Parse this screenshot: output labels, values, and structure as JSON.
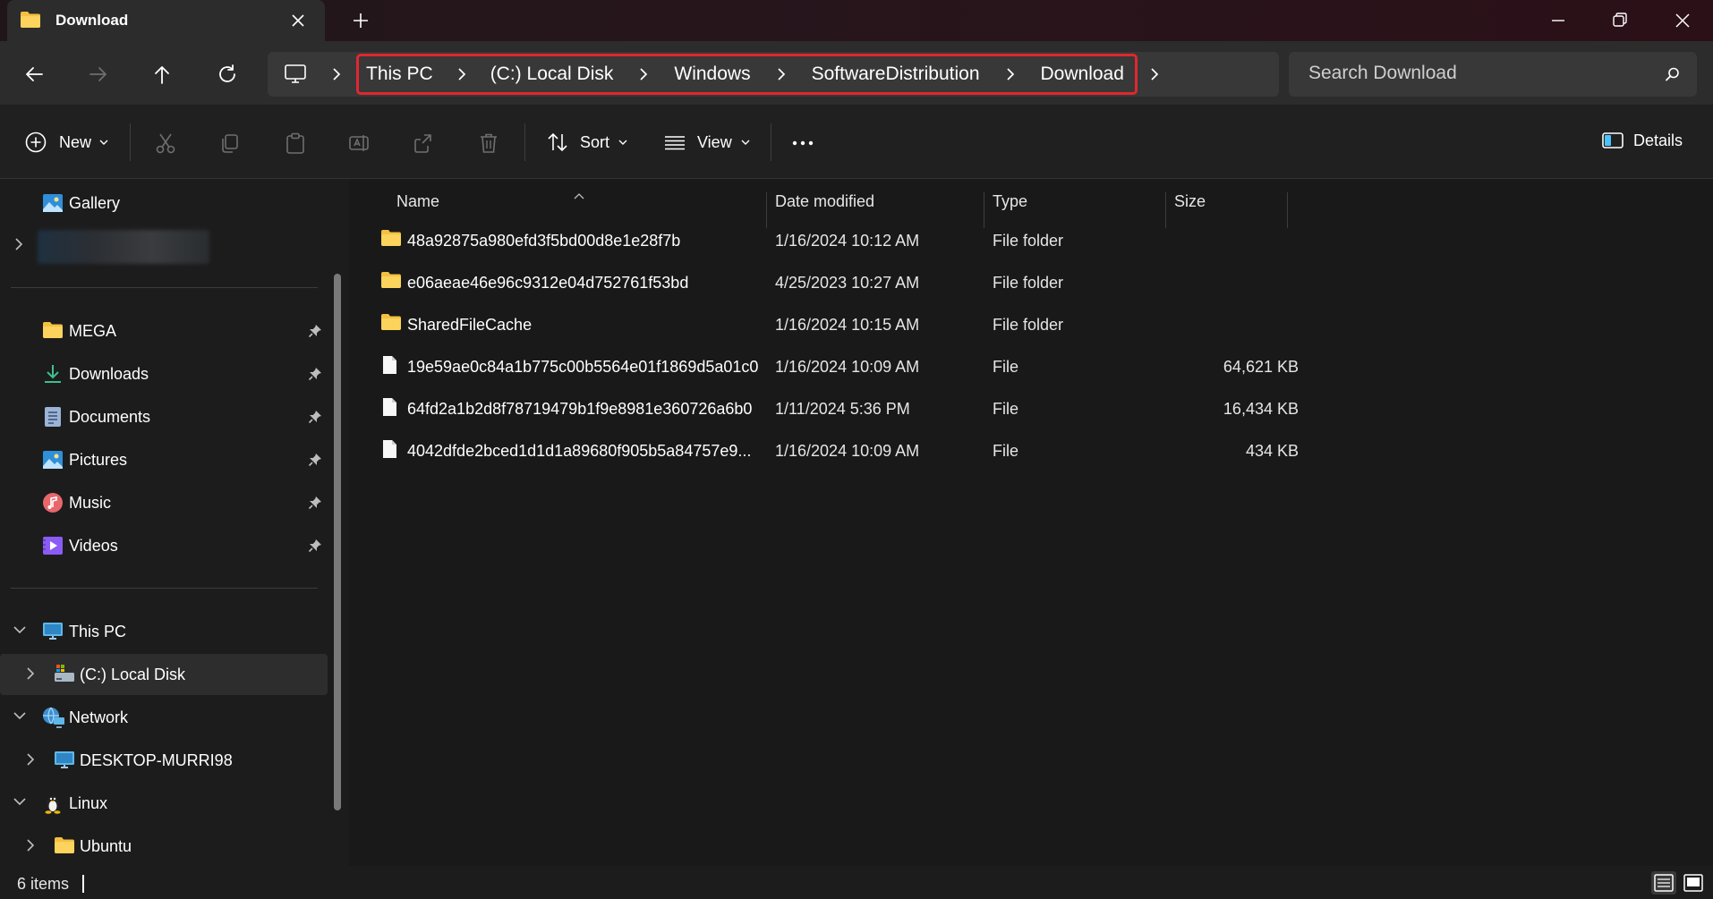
{
  "window": {
    "tab_title": "Download",
    "colors": {
      "folder": "#f4c042",
      "accent_highlight": "#e0282e"
    }
  },
  "address_bar": {
    "crumbs": [
      "This PC",
      "(C:) Local Disk",
      "Windows",
      "SoftwareDistribution",
      "Download"
    ]
  },
  "search": {
    "placeholder": "Search Download"
  },
  "command_bar": {
    "new_label": "New",
    "sort_label": "Sort",
    "view_label": "View",
    "details_label": "Details"
  },
  "sidebar": {
    "gallery": "Gallery",
    "quick_access": [
      "MEGA",
      "Downloads",
      "Documents",
      "Pictures",
      "Music",
      "Videos"
    ],
    "this_pc": "This PC",
    "local_disk": "(C:) Local Disk",
    "network": "Network",
    "desktop": "DESKTOP-MURRI98",
    "linux": "Linux",
    "ubuntu": "Ubuntu"
  },
  "columns": {
    "name": "Name",
    "date": "Date modified",
    "type": "Type",
    "size": "Size"
  },
  "files": [
    {
      "kind": "folder",
      "name": "48a92875a980efd3f5bd00d8e1e28f7b",
      "date": "1/16/2024 10:12 AM",
      "type": "File folder",
      "size": ""
    },
    {
      "kind": "folder",
      "name": "e06aeae46e96c9312e04d752761f53bd",
      "date": "4/25/2023 10:27 AM",
      "type": "File folder",
      "size": ""
    },
    {
      "kind": "folder",
      "name": "SharedFileCache",
      "date": "1/16/2024 10:15 AM",
      "type": "File folder",
      "size": ""
    },
    {
      "kind": "file",
      "name": "19e59ae0c84a1b775c00b5564e01f1869d5a01c0",
      "date": "1/16/2024 10:09 AM",
      "type": "File",
      "size": "64,621 KB"
    },
    {
      "kind": "file",
      "name": "64fd2a1b2d8f78719479b1f9e8981e360726a6b0",
      "date": "1/11/2024 5:36 PM",
      "type": "File",
      "size": "16,434 KB"
    },
    {
      "kind": "file",
      "name": "4042dfde2bced1d1d1a89680f905b5a84757e9...",
      "date": "1/16/2024 10:09 AM",
      "type": "File",
      "size": "434 KB"
    }
  ],
  "status_bar": {
    "item_count": "6 items"
  }
}
